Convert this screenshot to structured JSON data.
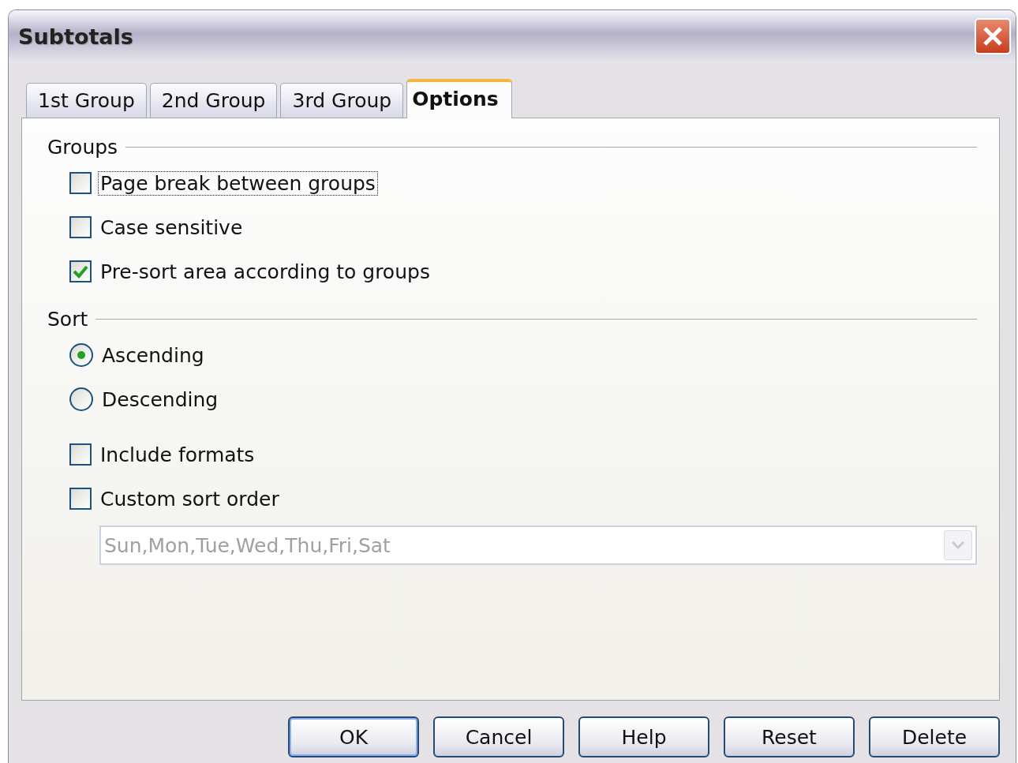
{
  "window": {
    "title": "Subtotals"
  },
  "tabs": [
    {
      "label": "1st Group",
      "selected": false
    },
    {
      "label": "2nd Group",
      "selected": false
    },
    {
      "label": "3rd Group",
      "selected": false
    },
    {
      "label": "Options",
      "selected": true
    }
  ],
  "groups": {
    "heading": "Groups",
    "options": [
      {
        "label": "Page break between groups",
        "checked": false,
        "focused": true
      },
      {
        "label": "Case sensitive",
        "checked": false,
        "focused": false
      },
      {
        "label": "Pre-sort area according to groups",
        "checked": true,
        "focused": false
      }
    ]
  },
  "sort": {
    "heading": "Sort",
    "radios": [
      {
        "label": "Ascending",
        "selected": true
      },
      {
        "label": "Descending",
        "selected": false
      }
    ],
    "options": [
      {
        "label": "Include formats",
        "checked": false,
        "focused": false
      },
      {
        "label": "Custom sort order",
        "checked": false,
        "focused": false
      }
    ],
    "sort_order": {
      "value": "Sun,Mon,Tue,Wed,Thu,Fri,Sat",
      "disabled": true
    }
  },
  "buttons": [
    {
      "label": "OK",
      "default": true
    },
    {
      "label": "Cancel",
      "default": false
    },
    {
      "label": "Help",
      "default": false
    },
    {
      "label": "Reset",
      "default": false
    },
    {
      "label": "Delete",
      "default": false
    }
  ]
}
